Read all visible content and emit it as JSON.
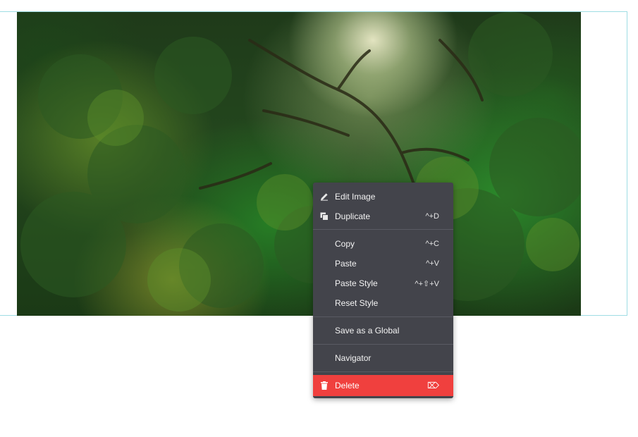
{
  "context_menu": {
    "items": [
      {
        "label": "Edit Image",
        "shortcut": "",
        "icon": "pencil-icon"
      },
      {
        "label": "Duplicate",
        "shortcut": "^+D",
        "icon": "duplicate-icon"
      },
      {
        "label": "Copy",
        "shortcut": "^+C"
      },
      {
        "label": "Paste",
        "shortcut": "^+V"
      },
      {
        "label": "Paste Style",
        "shortcut": "^+⇧+V"
      },
      {
        "label": "Reset Style",
        "shortcut": ""
      },
      {
        "label": "Save as a Global",
        "shortcut": ""
      },
      {
        "label": "Navigator",
        "shortcut": ""
      },
      {
        "label": "Delete",
        "shortcut": "⌦",
        "icon": "trash-icon"
      }
    ],
    "colors": {
      "menu_background": "#43444b",
      "danger": "#f0403e",
      "selection_outline": "#9fdde4"
    }
  },
  "image": {
    "subject": "forest-canopy-photo"
  }
}
